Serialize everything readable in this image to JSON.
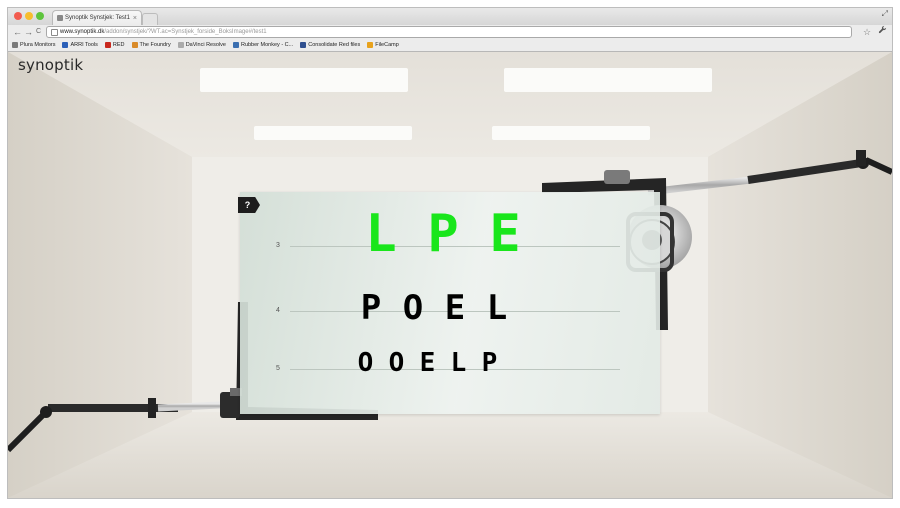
{
  "browser": {
    "tab_title": "Synoptik Synstjek: Test1",
    "tab_close": "×",
    "url_host": "www.synoptik.dk",
    "url_path": "/addon/synstjek/?WT.ac=Synstjek_forside_BoksImage#/test1",
    "nav": {
      "back": "←",
      "forward": "→",
      "reload": "C"
    },
    "star": "☆",
    "wrench": "🔧",
    "resize": "⤢",
    "bookmarks": [
      {
        "label": "Plura Monitors",
        "color": "#7a7a7a"
      },
      {
        "label": "ARRI Tools",
        "color": "#2b5fb8"
      },
      {
        "label": "RED",
        "color": "#c8281e"
      },
      {
        "label": "The Foundry",
        "color": "#d98b2a"
      },
      {
        "label": "DaVinci Resolve",
        "color": "#aaaaaa"
      },
      {
        "label": "Rubber Monkey - C...",
        "color": "#3b6fb0"
      },
      {
        "label": "Consolidate Red files",
        "color": "#2f4f8f"
      },
      {
        "label": "FileCamp",
        "color": "#e8a21c"
      }
    ]
  },
  "page": {
    "logo": "synoptik",
    "help_label": "?",
    "chart_rows": [
      {
        "number": "3",
        "letters": [
          "L",
          "P",
          "E"
        ],
        "color": "#19e61b"
      },
      {
        "number": "4",
        "letters": [
          "P",
          "O",
          "E",
          "L"
        ],
        "color": "#000000"
      },
      {
        "number": "5",
        "letters": [
          "O",
          "O",
          "E",
          "L",
          "P"
        ],
        "color": "#000000"
      }
    ]
  }
}
